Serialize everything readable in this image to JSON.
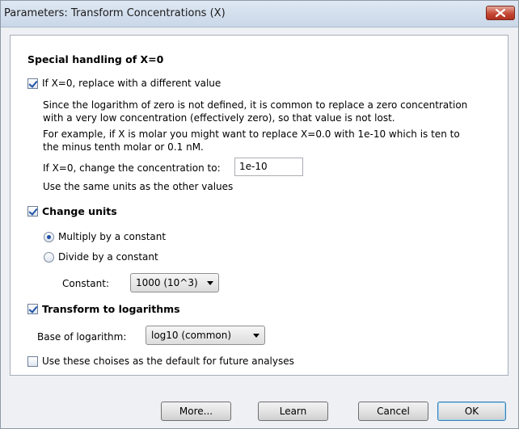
{
  "window": {
    "title": "Parameters: Transform Concentrations (X)",
    "close_icon": "close-x-icon"
  },
  "special": {
    "heading": "Special handling of X=0",
    "replace_checkbox_label": "If X=0, replace with a different value",
    "replace_checked": true,
    "para1_line1": "Since the logarithm of zero is not defined, it is common to replace a zero concentration",
    "para1_line2": "with a very low concentration (effectively zero), so that value is not lost.",
    "para2_line1": "For example, if X is molar you might want to replace X=0.0 with 1e-10 which is ten to",
    "para2_line2": "the minus tenth molar or  0.1 nM.",
    "change_label": "If X=0, change the concentration to:",
    "change_value": "1e-10",
    "units_note": "Use the same units as the other values"
  },
  "units": {
    "checkbox_label": "Change units",
    "checked": true,
    "multiply_label": "Multiply by a constant",
    "multiply_selected": true,
    "divide_label": "Divide by a constant",
    "divide_selected": false,
    "constant_label": "Constant:",
    "constant_value": "1000 (10^3)"
  },
  "logs": {
    "checkbox_label": "Transform to logarithms",
    "checked": true,
    "base_label": "Base of logarithm:",
    "base_value": "log10 (common)"
  },
  "default_choice": {
    "label": "Use these choises as the default for future analyses",
    "checked": false
  },
  "buttons": {
    "more": "More...",
    "learn": "Learn",
    "cancel": "Cancel",
    "ok": "OK"
  }
}
